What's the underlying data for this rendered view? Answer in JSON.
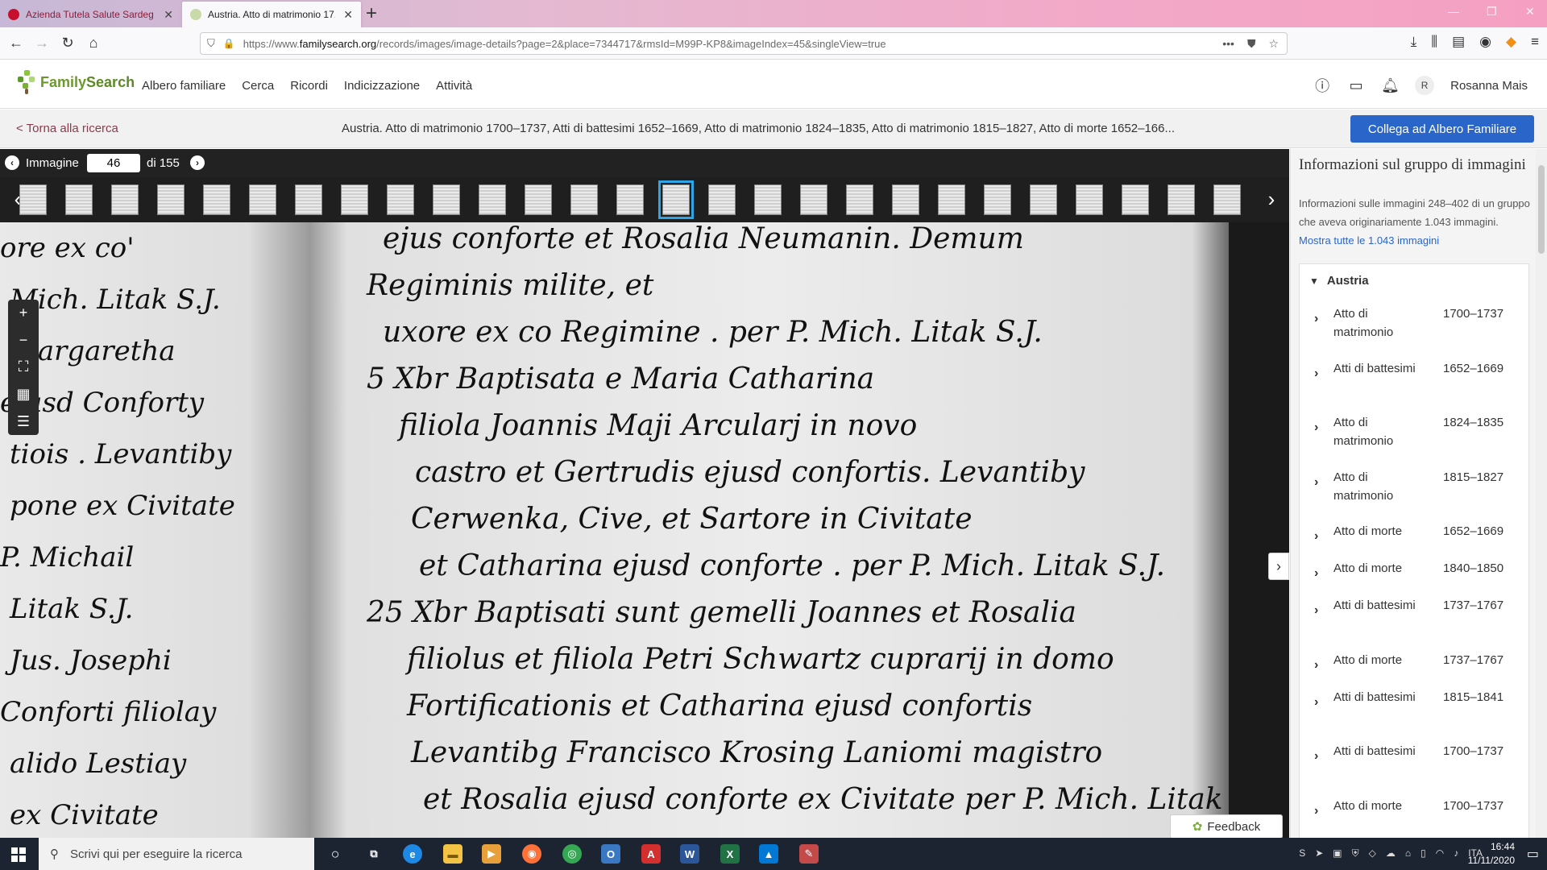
{
  "browser": {
    "tabs": [
      {
        "title": "Azienda Tutela Salute Sardegna",
        "active": false
      },
      {
        "title": "Austria. Atto di matrimonio 17...",
        "active": true
      }
    ],
    "url_prefix": "https://www.",
    "url_domain": "familysearch.org",
    "url_path": "/records/images/image-details?page=2&place=7344717&rmsId=M99P-KP8&imageIndex=45&singleView=true"
  },
  "header": {
    "logo_part1": "Family",
    "logo_part2": "Search",
    "nav": [
      "Albero familiare",
      "Cerca",
      "Ricordi",
      "Indicizzazione",
      "Attività"
    ],
    "avatar_initial": "R",
    "user_name": "Rosanna Mais"
  },
  "record": {
    "back_link": "< Torna alla ricerca",
    "title": "Austria. Atto di matrimonio 1700–1737, Atti di battesimi 1652–1669, Atto di matrimonio 1824–1835, Atto di matrimonio 1815–1827, Atto di morte 1652–166...",
    "attach_button": "Collega ad Albero Familiare"
  },
  "viewer": {
    "image_label": "Immagine",
    "current_image": "46",
    "of_label": "di 155",
    "thumbnail_count": 27,
    "selected_thumbnail": 14,
    "feedback_label": "Feedback"
  },
  "handwriting": {
    "left": [
      "ore ex co'",
      "Mich. Litak S.J.",
      "Margaretha",
      "ejusd Conforty",
      "tiois . Levantiby",
      "pone ex Civitate",
      "P. Michail",
      "Litak S.J.",
      "Jus. Josephi",
      "Conforti filiolay",
      "alido Lestiay",
      "ex Civitate"
    ],
    "right": [
      "ejus conforte et Rosalia Neumanin. Demum",
      "Regiminis milite, et",
      "uxore ex co Regimine . per P. Mich. Litak S.J.",
      "5 Xbr Baptisata e Maria Catharina",
      "filiola Joannis Maji Arcularj in novo",
      "castro et Gertrudis ejusd confortis. Levantiby",
      "Cerwenka, Cive, et Sartore in Civitate",
      "et Catharina ejusd conforte . per P. Mich. Litak S.J.",
      "25 Xbr Baptisati sunt gemelli Joannes et Rosalia",
      "filiolus et filiola Petri Schwartz cuprarij in domo",
      "Fortificationis et Catharina ejusd confortis",
      "Levantibg Francisco Krosing Laniomi magistro",
      "et Rosalia ejusd conforte ex Civitate per P. Mich. Litak"
    ]
  },
  "panel": {
    "title": "Informazioni sul gruppo di immagini",
    "description": "Informazioni sulle immagini 248–402 di un gruppo che aveva originariamente 1.043 immagini.",
    "show_all_link": "Mostra tutte le 1.043 immagini",
    "group": "Austria",
    "items": [
      {
        "name": "Atto di matrimonio",
        "years": "1700–1737"
      },
      {
        "name": "Atti di battesimi",
        "years": "1652–1669"
      },
      {
        "name": "Atto di matrimonio",
        "years": "1824–1835"
      },
      {
        "name": "Atto di matrimonio",
        "years": "1815–1827"
      },
      {
        "name": "Atto di morte",
        "years": "1652–1669"
      },
      {
        "name": "Atto di morte",
        "years": "1840–1850"
      },
      {
        "name": "Atti di battesimi",
        "years": "1737–1767"
      },
      {
        "name": "Atto di morte",
        "years": "1737–1767"
      },
      {
        "name": "Atti di battesimi",
        "years": "1815–1841"
      },
      {
        "name": "Atti di battesimi",
        "years": "1700–1737"
      },
      {
        "name": "Atto di morte",
        "years": "1700–1737"
      }
    ]
  },
  "taskbar": {
    "search_placeholder": "Scrivi qui per eseguire la ricerca",
    "language": "ITA",
    "time": "16:44",
    "date": "11/11/2020"
  },
  "colors": {
    "accent_blue": "#2a66c9",
    "thumb_selected": "#2fa4e7",
    "brand_green": "#6b9a2c",
    "back_link": "#8a3b4b"
  }
}
